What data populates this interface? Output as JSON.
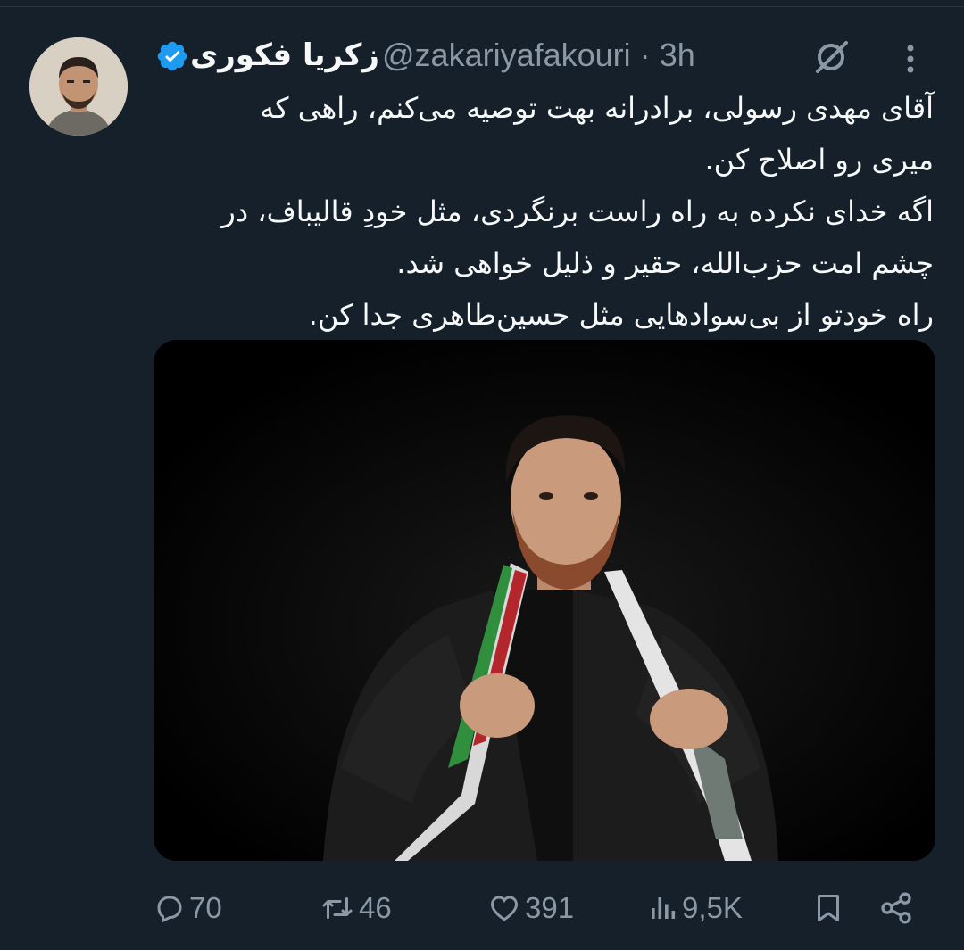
{
  "tweet": {
    "author": {
      "display_name": "زکریا فکوری",
      "handle": "@zakariyafakouri",
      "verified": true,
      "avatar_icon": "user-avatar"
    },
    "separator": "·",
    "timestamp": "3h",
    "text_lines": [
      "آقای مهدی رسولی، برادرانه بهت توصیه می‌کنم، راهی که",
      "میری رو اصلاح کن.",
      "اگه خدای نکرده به راه راست برنگردی، مثل خودِ قالیباف، در",
      "چشم امت حزب‌الله، حقیر و ذلیل خواهی شد.",
      "راه خودتو از بی‌سوادهایی مثل حسین‌طاهری جدا کن."
    ],
    "media": {
      "type": "photo"
    },
    "metrics": {
      "replies": "70",
      "retweets": "46",
      "likes": "391",
      "views": "9,5K"
    }
  },
  "icons": {
    "verified": "verified-badge-icon",
    "grok": "grok-icon",
    "more": "more-options-icon",
    "reply": "reply-icon",
    "retweet": "retweet-icon",
    "like": "like-icon",
    "views": "views-icon",
    "bookmark": "bookmark-icon",
    "share": "share-icon"
  },
  "colors": {
    "background": "#15202b",
    "text": "#f7f9f9",
    "secondary": "#8b98a5",
    "verified": "#1d9bf0"
  }
}
